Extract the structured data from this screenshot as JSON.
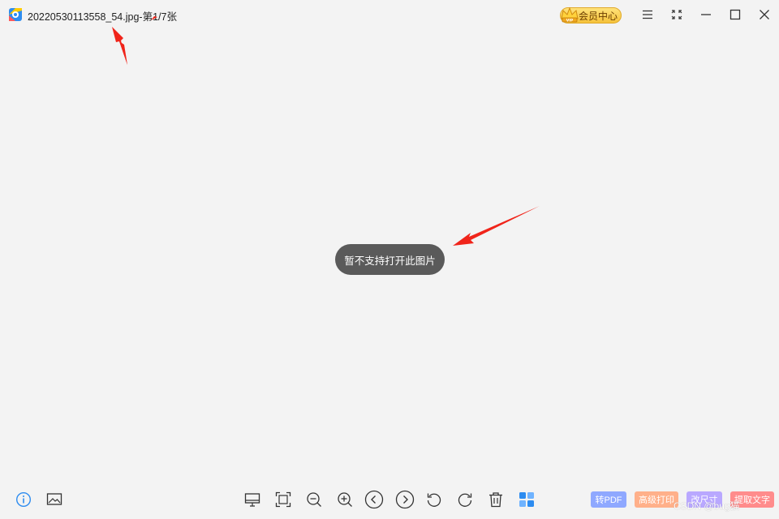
{
  "titlebar": {
    "title": "20220530113558_54.jpg-第1/7张",
    "vip_label": "会员中心"
  },
  "viewer": {
    "message": "暂不支持打开此图片"
  },
  "bottom_tags": [
    {
      "label": "转PDF",
      "color": "#8fa8ff"
    },
    {
      "label": "高级打印",
      "color": "#ffb08a"
    },
    {
      "label": "改尺寸",
      "color": "#b9a8ff"
    },
    {
      "label": "提取文字",
      "color": "#ff8c8c"
    }
  ],
  "watermark": "CSDN @bug猫",
  "colors": {
    "background": "#f3f3f3",
    "toast": "#5a5a5a",
    "accent": "#2d8cf0",
    "annotation": "#f0241a"
  }
}
